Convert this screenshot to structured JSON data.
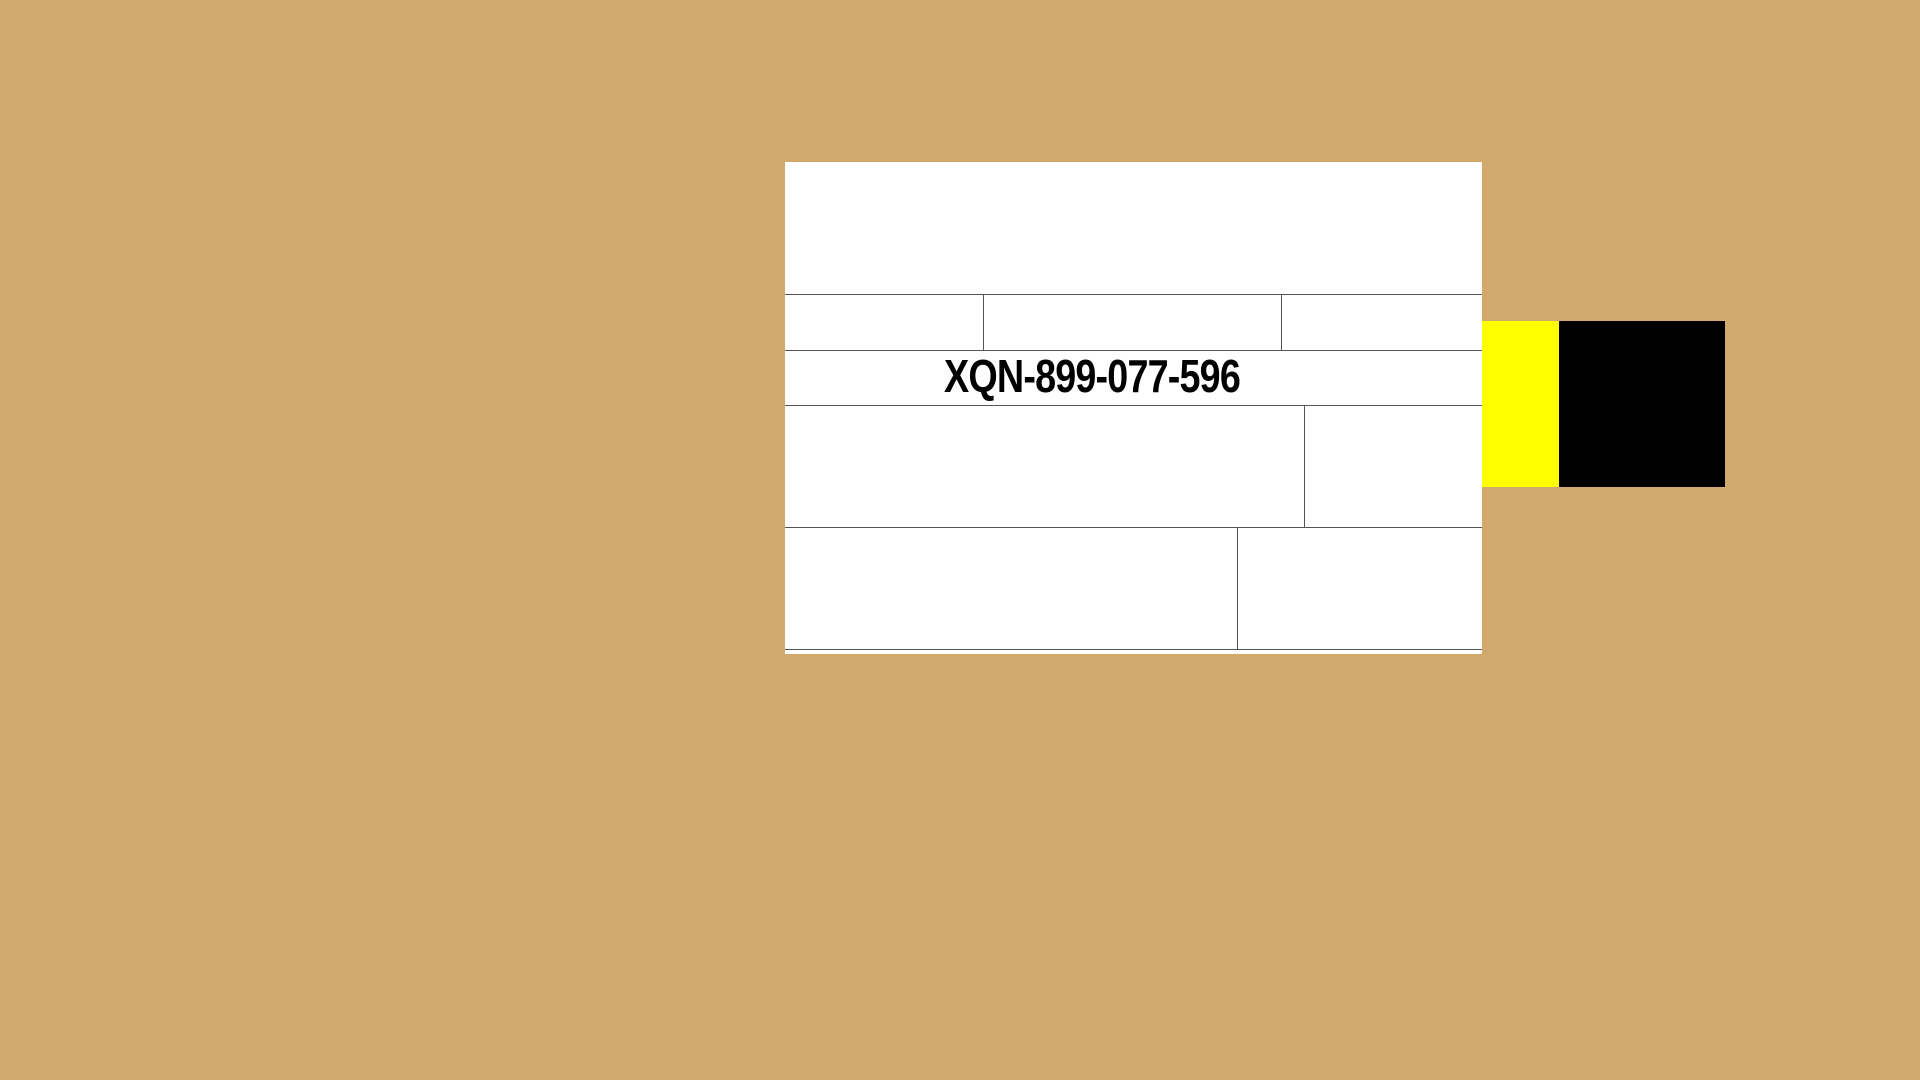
{
  "background_color": "#d1a86d",
  "label": {
    "tracking_number": "XQN-899-077-596",
    "background_color": "#ffffff",
    "text_color": "#000000"
  },
  "tape": {
    "yellow_color": "#ffff00",
    "black_color": "#000000"
  }
}
